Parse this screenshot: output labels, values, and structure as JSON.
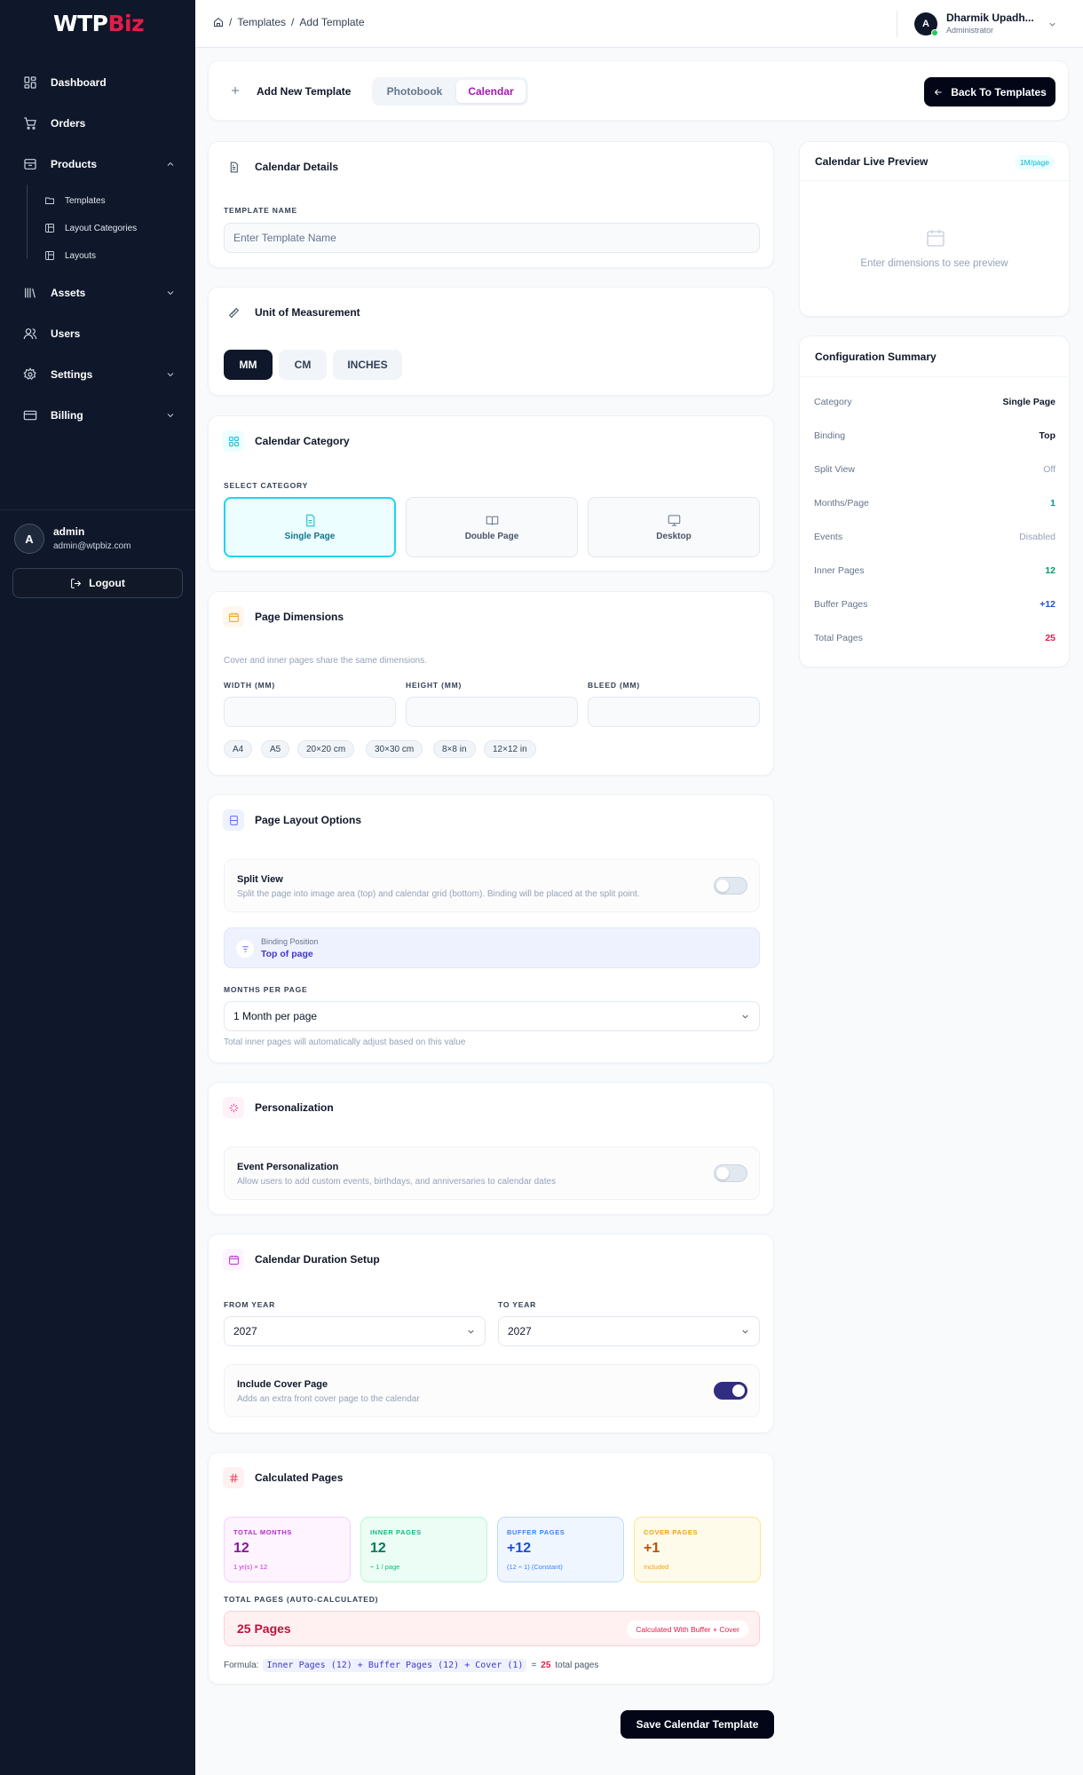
{
  "brand": {
    "part1": "WTP",
    "part2": "Biz"
  },
  "sidebar": {
    "items": [
      {
        "label": "Dashboard",
        "icon": "grid-icon"
      },
      {
        "label": "Orders",
        "icon": "cart-icon"
      },
      {
        "label": "Products",
        "icon": "box-icon"
      },
      {
        "label": "Assets",
        "icon": "library-icon"
      },
      {
        "label": "Users",
        "icon": "users-icon"
      },
      {
        "label": "Settings",
        "icon": "gear-icon"
      },
      {
        "label": "Billing",
        "icon": "card-icon"
      }
    ],
    "subitems": [
      {
        "label": "Templates",
        "icon": "folder-icon"
      },
      {
        "label": "Layout Categories",
        "icon": "layout-icon"
      },
      {
        "label": "Layouts",
        "icon": "layout-icon"
      }
    ],
    "user": {
      "initial": "A",
      "name": "admin",
      "email": "admin@wtpbiz.com"
    },
    "logout_label": "Logout"
  },
  "topbar": {
    "breadcrumb": [
      "Templates",
      "Add Template"
    ],
    "sep": "/",
    "user": {
      "initial": "A",
      "name": "Dharmik Upadh...",
      "role": "Administrator"
    }
  },
  "header": {
    "title": "Add New Template",
    "tabs": [
      "Photobook",
      "Calendar"
    ],
    "active_tab": "Calendar",
    "back_label": "Back To Templates"
  },
  "details": {
    "title": "Calendar Details",
    "name_label": "TEMPLATE NAME",
    "name_placeholder": "Enter Template Name"
  },
  "unit": {
    "title": "Unit of Measurement",
    "options": [
      "MM",
      "CM",
      "INCHES"
    ],
    "selected": "MM"
  },
  "category": {
    "title": "Calendar Category",
    "label": "SELECT CATEGORY",
    "options": [
      "Single Page",
      "Double Page",
      "Desktop"
    ],
    "selected": "Single Page"
  },
  "dimensions": {
    "title": "Page Dimensions",
    "hint": "Cover and inner pages share the same dimensions.",
    "width_label": "WIDTH (MM)",
    "height_label": "HEIGHT (MM)",
    "bleed_label": "BLEED (MM)",
    "presets": [
      "A4",
      "A5",
      "20×20 cm",
      "30×30 cm",
      "8×8 in",
      "12×12 in"
    ]
  },
  "layout": {
    "title": "Page Layout Options",
    "split_title": "Split View",
    "split_desc": "Split the page into image area (top) and calendar grid (bottom). Binding will be placed at the split point.",
    "split_on": false,
    "binding_label": "Binding Position",
    "binding_value": "Top of page",
    "months_label": "MONTHS PER PAGE",
    "months_value": "1 Month per page",
    "months_hint": "Total inner pages will automatically adjust based on this value"
  },
  "personalization": {
    "title": "Personalization",
    "event_title": "Event Personalization",
    "event_desc": "Allow users to add custom events, birthdays, and anniversaries to calendar dates",
    "event_on": false
  },
  "duration": {
    "title": "Calendar Duration Setup",
    "from_label": "FROM YEAR",
    "from_value": "2027",
    "to_label": "TO YEAR",
    "to_value": "2027",
    "cover_title": "Include Cover Page",
    "cover_desc": "Adds an extra front cover page to the calendar",
    "cover_on": true
  },
  "calculated": {
    "title": "Calculated Pages",
    "stats": [
      {
        "title": "TOTAL MONTHS",
        "value": "12",
        "sub": "1 yr(s) × 12",
        "color": "#a21caf"
      },
      {
        "title": "INNER PAGES",
        "value": "12",
        "sub": "÷ 1 / page",
        "color": "#059669"
      },
      {
        "title": "BUFFER PAGES",
        "value": "+12",
        "sub": "(12 ÷ 1) (Constant)",
        "color": "#1d4ed8"
      },
      {
        "title": "COVER PAGES",
        "value": "+1",
        "sub": "Included",
        "color": "#b45309"
      }
    ],
    "total_label": "TOTAL PAGES (AUTO-CALCULATED)",
    "total_value": "25 Pages",
    "total_badge": "Calculated With Buffer + Cover",
    "formula_prefix": "Formula:",
    "formula_code": "Inner Pages (12) + Buffer Pages (12) + Cover (1)",
    "formula_eq": "=",
    "formula_total": "25",
    "formula_suffix": "total pages"
  },
  "save_label": "Save Calendar Template",
  "preview": {
    "title": "Calendar Live Preview",
    "badge": "1M/page",
    "empty_text": "Enter dimensions to see preview"
  },
  "summary": {
    "title": "Configuration Summary",
    "rows": [
      {
        "key": "Category",
        "value": "Single Page",
        "color": "#0f172a"
      },
      {
        "key": "Binding",
        "value": "Top",
        "color": "#0f172a"
      },
      {
        "key": "Split View",
        "value": "Off",
        "color": "#94a3b8"
      },
      {
        "key": "Months/Page",
        "value": "1",
        "color": "#0891b2"
      },
      {
        "key": "Events",
        "value": "Disabled",
        "color": "#94a3b8"
      },
      {
        "key": "Inner Pages",
        "value": "12",
        "color": "#059669"
      },
      {
        "key": "Buffer Pages",
        "value": "+12",
        "color": "#1d4ed8"
      },
      {
        "key": "Total Pages",
        "value": "25",
        "color": "#e11d48"
      }
    ]
  }
}
